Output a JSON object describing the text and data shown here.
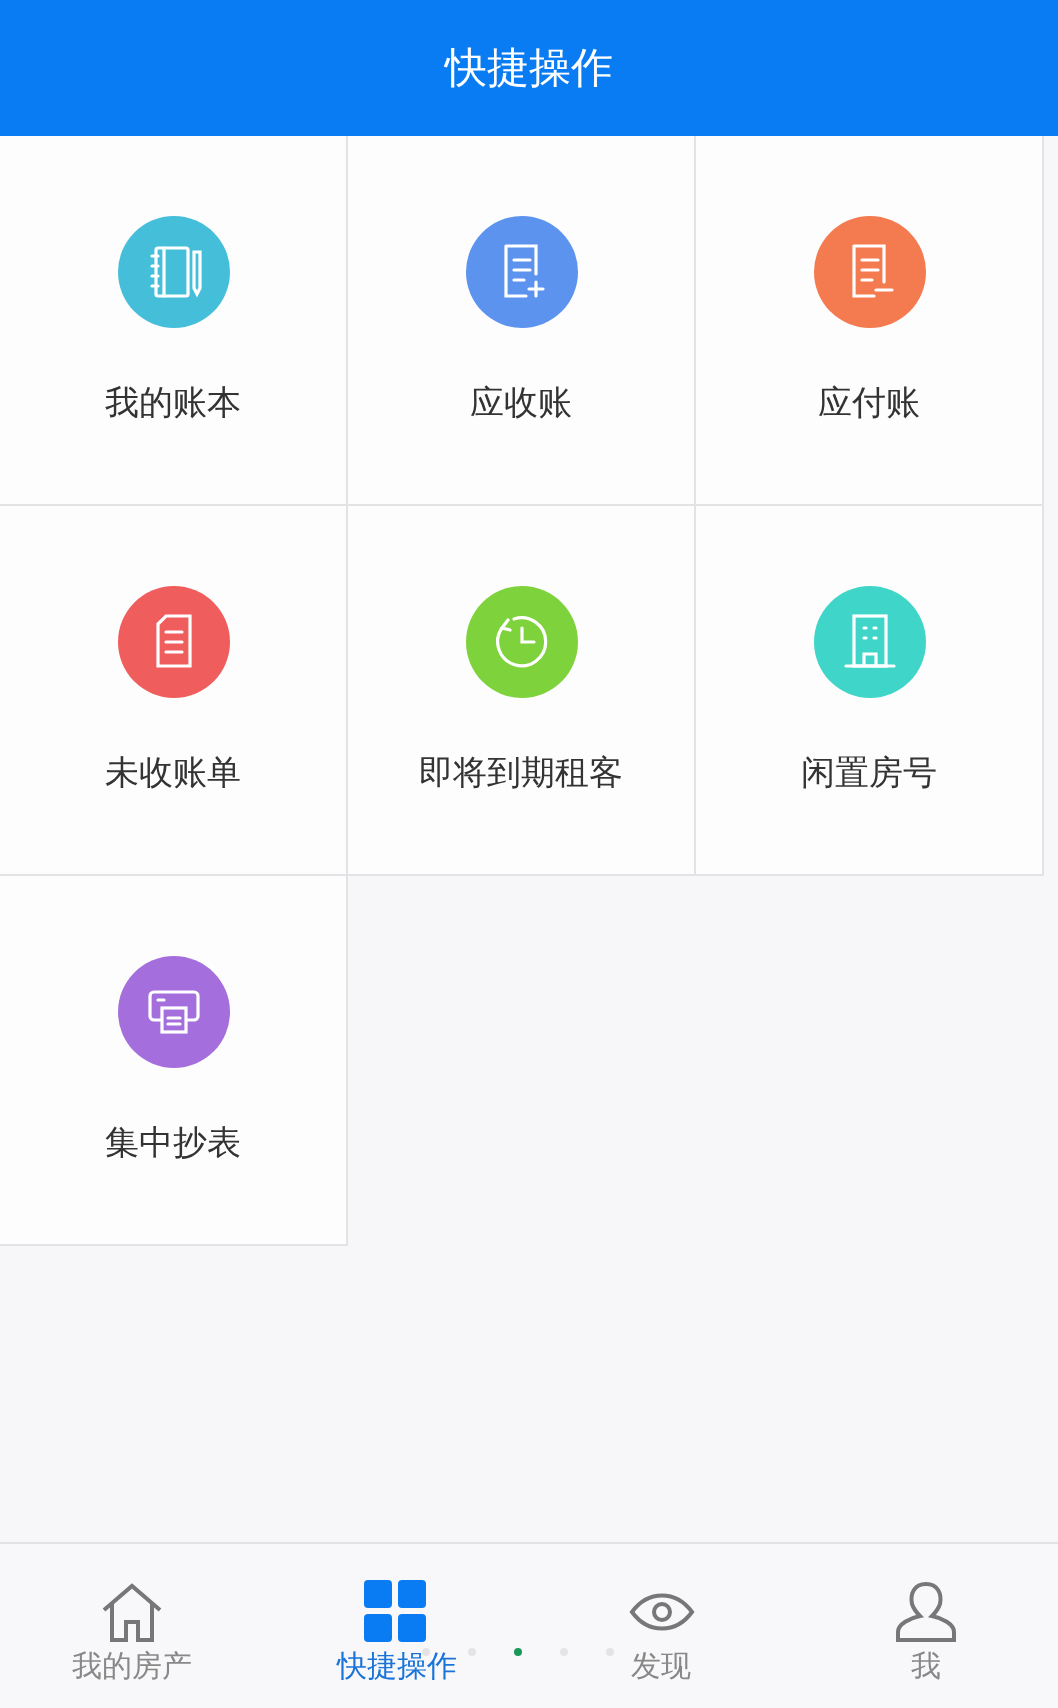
{
  "header": {
    "title": "快捷操作"
  },
  "actions": [
    {
      "label": "我的账本",
      "kind": "notebook",
      "color": "#45bfd9"
    },
    {
      "label": "应收账",
      "kind": "receivable",
      "color": "#5b93ee"
    },
    {
      "label": "应付账",
      "kind": "payable",
      "color": "#f47a4f"
    },
    {
      "label": "未收账单",
      "kind": "bill",
      "color": "#ef5d5d"
    },
    {
      "label": "即将到期租客",
      "kind": "clock",
      "color": "#7ed23c"
    },
    {
      "label": "闲置房号",
      "kind": "building",
      "color": "#3fd6c9"
    },
    {
      "label": "集中抄表",
      "kind": "printer",
      "color": "#a46fdc"
    }
  ],
  "page_dots": [
    {
      "selected": false
    },
    {
      "selected": false
    },
    {
      "selected": true
    },
    {
      "selected": false
    },
    {
      "selected": false
    }
  ],
  "tab_bar": [
    {
      "label": "我的房产",
      "kind": "house",
      "selected": false
    },
    {
      "label": "快捷操作",
      "kind": "grid",
      "selected": true
    },
    {
      "label": "发现",
      "kind": "eye",
      "selected": false
    },
    {
      "label": "我",
      "kind": "person",
      "selected": false
    }
  ]
}
